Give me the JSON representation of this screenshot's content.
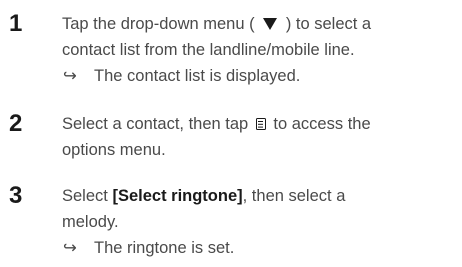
{
  "steps": [
    {
      "number": "1",
      "line1_pre": "Tap the drop-down menu (",
      "line1_post": ") to select a",
      "line2": "contact list from the landline/mobile line.",
      "result": "The contact list is displayed."
    },
    {
      "number": "2",
      "line1_pre": "Select a contact, then tap",
      "line1_post": "to access the",
      "line2": "options menu."
    },
    {
      "number": "3",
      "line1_pre": "Select ",
      "line1_bold": "[Select ringtone]",
      "line1_post": ", then select a",
      "line2": "melody.",
      "result": "The ringtone is set."
    }
  ],
  "result_arrow": "↪",
  "icons": {
    "dropdown": "down-triangle-icon",
    "options": "menu-icon"
  }
}
